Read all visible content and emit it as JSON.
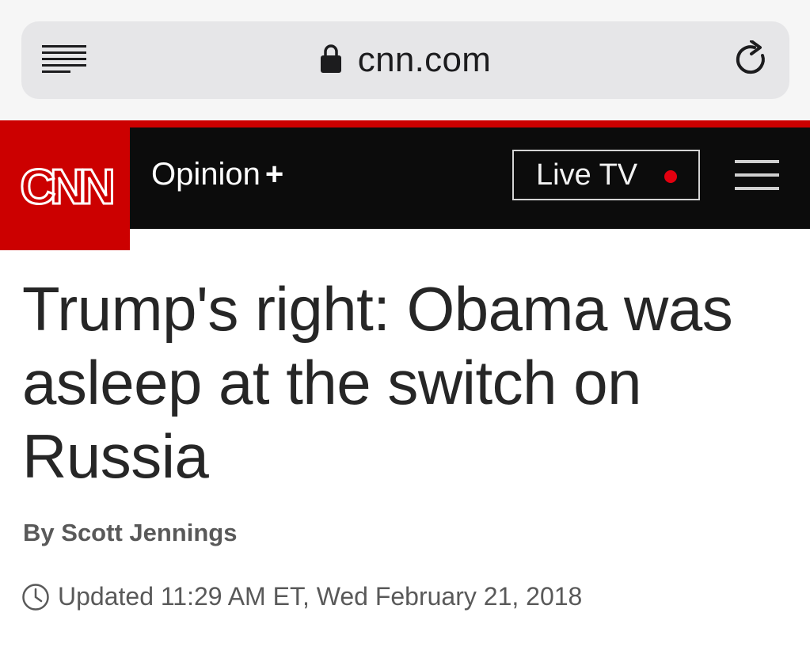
{
  "browser": {
    "url": "cnn.com",
    "icons": [
      "menu-lines-icon",
      "lock-icon",
      "reload-icon"
    ]
  },
  "nav": {
    "logo_text": "CNN",
    "section": "Opinion",
    "section_plus": "+",
    "live_tv_label": "Live TV",
    "icons": [
      "live-dot-icon",
      "hamburger-icon"
    ]
  },
  "article": {
    "headline": "Trump's right: Obama was asleep at the switch on Russia",
    "byline_prefix": "By",
    "author": "Scott Jennings",
    "timestamp": "Updated 11:29 AM ET, Wed February 21, 2018"
  },
  "colors": {
    "brand_red": "#cc0000",
    "nav_black": "#0c0c0c",
    "live_dot": "#e3000f",
    "headline": "#262626",
    "meta_gray": "#595959"
  }
}
